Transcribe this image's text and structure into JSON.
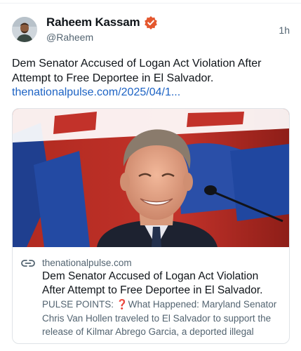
{
  "author": {
    "display_name": "Raheem Kassam",
    "handle": "@Raheem",
    "verified_icon": "verified-badge-icon",
    "badge_color": "#e4572e"
  },
  "post": {
    "timestamp": "1h",
    "text": "Dem Senator Accused of Logan Act Violation After Attempt to Free Deportee in El Salvador.",
    "link_text": "thenationalpulse.com/2025/04/1..."
  },
  "card": {
    "image_icon": "article-photo",
    "link_icon": "link-icon",
    "domain": "thenationalpulse.com",
    "title": "Dem Senator Accused of Logan Act Violation After Attempt to Free Deportee in El Salvador.",
    "desc_prefix": "PULSE POINTS: ",
    "desc_mark": "❓",
    "desc_body": "What Happened: Maryland Senator Chris Van Hollen traveled to El Salvador to support the release of Kilmar Abrego Garcia, a deported illegal"
  },
  "colors": {
    "link": "#1d63c4",
    "text_secondary": "#536471",
    "accent_red": "#e0245e"
  }
}
